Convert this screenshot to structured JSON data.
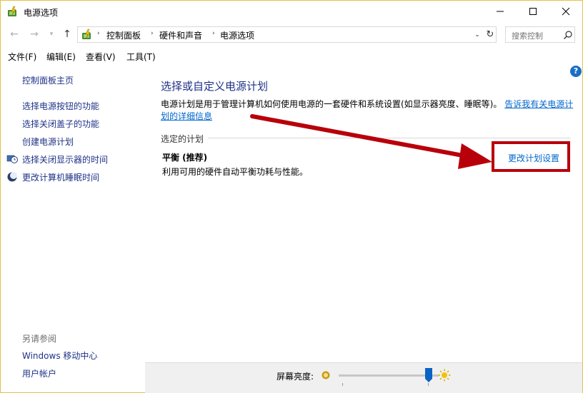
{
  "window": {
    "title": "电源选项",
    "controls": {
      "minimize": "—",
      "maximize": "☐",
      "close": "✕"
    }
  },
  "nav": {
    "breadcrumbs": [
      "控制面板",
      "硬件和声音",
      "电源选项"
    ],
    "search_placeholder": "搜索控制"
  },
  "menu": {
    "items": [
      "文件(F)",
      "编辑(E)",
      "查看(V)",
      "工具(T)"
    ]
  },
  "sidebar": {
    "items": [
      {
        "label": "控制面板主页"
      },
      {
        "label": "选择电源按钮的功能"
      },
      {
        "label": "选择关闭盖子的功能"
      },
      {
        "label": "创建电源计划"
      },
      {
        "label": "选择关闭显示器的时间",
        "icon": "display-clock-icon"
      },
      {
        "label": "更改计算机睡眠时间",
        "icon": "moon-icon"
      }
    ],
    "see_also_label": "另请参阅",
    "see_also": [
      "Windows 移动中心",
      "用户帐户"
    ]
  },
  "main": {
    "title": "选择或自定义电源计划",
    "description": "电源计划是用于管理计算机如何使用电源的一套硬件和系统设置(如显示器亮度、睡眠等)。",
    "description_link": "告诉我有关电源计划的详细信息",
    "section_label": "选定的计划",
    "plan": {
      "name": "平衡 (推荐)",
      "description": "利用可用的硬件自动平衡功耗与性能。",
      "change_link": "更改计划设置"
    }
  },
  "bottom": {
    "brightness_label": "屏幕亮度:",
    "brightness_level": 0.9
  },
  "colors": {
    "link": "#0066cc",
    "heading": "#1e3287",
    "annotation": "#b8000b",
    "accent": "#0a62c4"
  }
}
